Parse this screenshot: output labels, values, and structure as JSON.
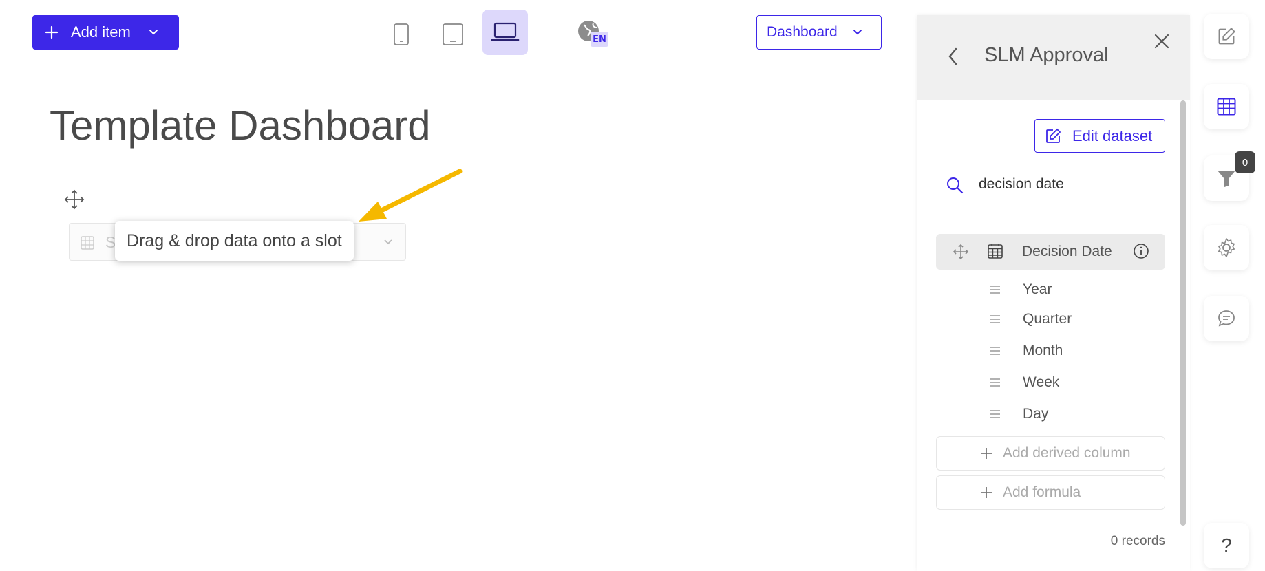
{
  "toolbar": {
    "add_item_label": "Add item",
    "language_code": "EN",
    "view_select_value": "Dashboard"
  },
  "canvas": {
    "title": "Template Dashboard",
    "slot_placeholder_letter": "S",
    "tooltip": "Drag & drop data onto a slot"
  },
  "panel": {
    "title": "SLM Approval",
    "edit_dataset_label": "Edit dataset",
    "search_value": "decision date",
    "column": {
      "name": "Decision Date",
      "sub_items": [
        "Year",
        "Quarter",
        "Month",
        "Week",
        "Day"
      ]
    },
    "add_derived_label": "Add derived column",
    "add_formula_label": "Add formula",
    "records_label": "0 records"
  },
  "right_toolbar": {
    "filter_count": "0",
    "help_label": "?"
  },
  "colors": {
    "accent": "#3d27e8",
    "annotation_arrow": "#f5b800"
  }
}
